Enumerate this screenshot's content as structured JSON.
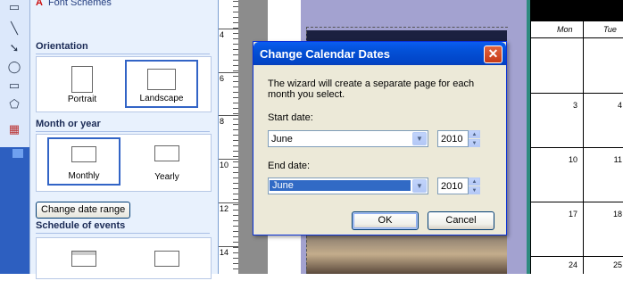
{
  "taskpane": {
    "top_link": "Font Schemes",
    "orientation": {
      "heading": "Orientation",
      "options": [
        {
          "label": "Portrait",
          "selected": false
        },
        {
          "label": "Landscape",
          "selected": true
        }
      ]
    },
    "month_or_year": {
      "heading": "Month or year",
      "options": [
        {
          "label": "Monthly",
          "selected": true
        },
        {
          "label": "Yearly",
          "selected": false
        }
      ]
    },
    "change_range_button": "Change date range",
    "schedule": {
      "heading": "Schedule of events"
    }
  },
  "ruler": {
    "numbers": [
      "4",
      "6",
      "8",
      "10",
      "12",
      "14"
    ]
  },
  "calendar": {
    "headers": [
      "Mon",
      "Tue"
    ],
    "rows": [
      [
        "",
        ""
      ],
      [
        "3",
        "4"
      ],
      [
        "10",
        "11"
      ],
      [
        "17",
        "18"
      ],
      [
        "24",
        "25"
      ]
    ]
  },
  "dialog": {
    "title": "Change Calendar Dates",
    "close_glyph": "✕",
    "description": "The wizard will create a separate page for each month you select.",
    "start_label": "Start date:",
    "start_month": "June",
    "start_year": "2010",
    "end_label": "End date:",
    "end_month": "June",
    "end_year": "2010",
    "ok": "OK",
    "cancel": "Cancel"
  },
  "colors": {
    "titlebar": "#0350d6",
    "selection_border": "#3264c6",
    "highlight": "#316ac5",
    "lavender_background": "#a3a2d0",
    "teal_accent": "#2e8b7f"
  }
}
